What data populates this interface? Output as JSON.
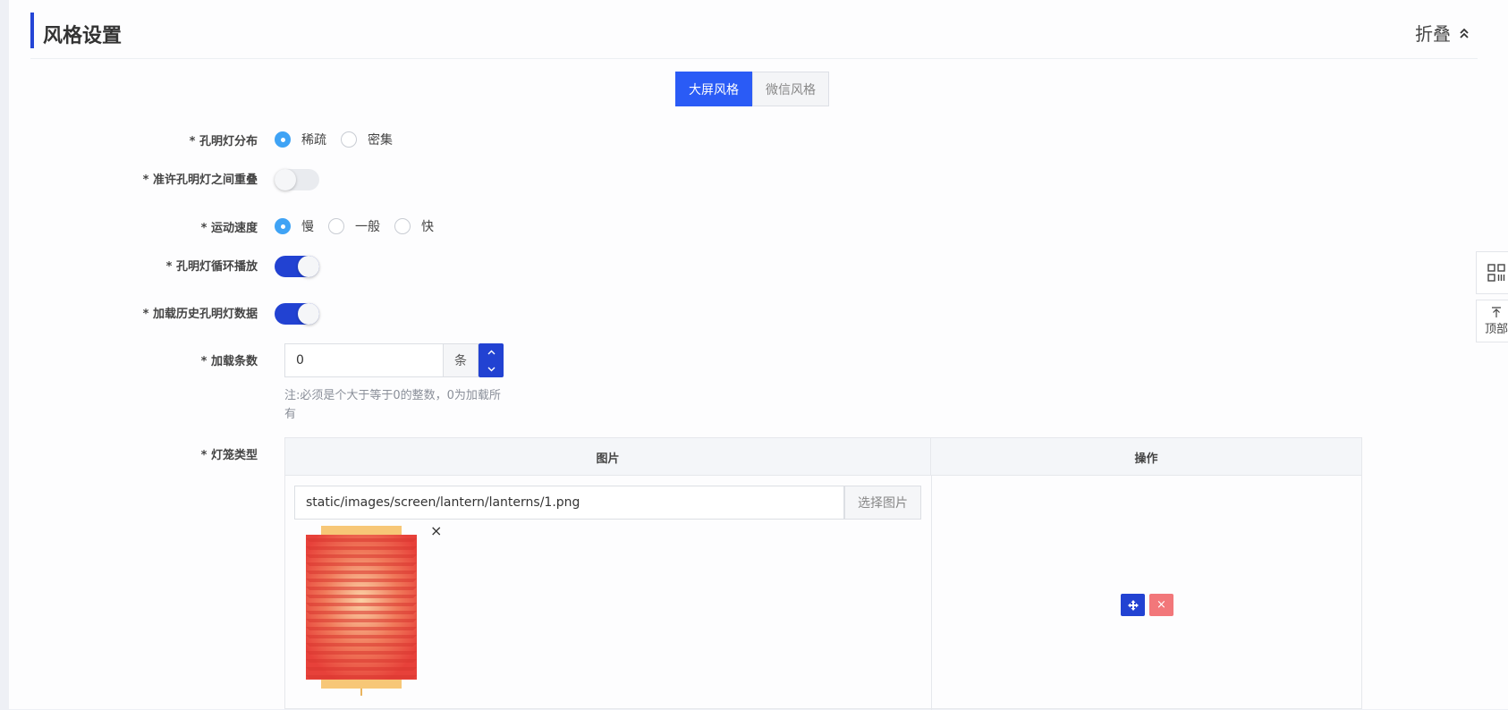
{
  "header": {
    "title": "风格设置",
    "collapse_label": "折叠",
    "accent": "#2445d6"
  },
  "tabs": [
    {
      "label": "大屏风格",
      "active": true
    },
    {
      "label": "微信风格",
      "active": false
    }
  ],
  "form": {
    "distribution": {
      "label": "* 孔明灯分布",
      "options": [
        "稀疏",
        "密集"
      ],
      "selected": "稀疏"
    },
    "overlap": {
      "label": "* 准许孔明灯之间重叠",
      "on": false
    },
    "speed": {
      "label": "* 运动速度",
      "options": [
        "慢",
        "一般",
        "快"
      ],
      "selected": "慢"
    },
    "loop": {
      "label": "* 孔明灯循环播放",
      "on": true
    },
    "history": {
      "label": "* 加载历史孔明灯数据",
      "on": true
    },
    "count": {
      "label": "* 加载条数",
      "value": "0",
      "unit": "条",
      "note": "注:必须是个大于等于0的整数，0为加载所有"
    },
    "lantern_type": {
      "label": "* 灯笼类型"
    }
  },
  "table": {
    "headers": [
      "图片",
      "操作"
    ],
    "rows": [
      {
        "path": "static/images/screen/lantern/lanterns/1.png",
        "choose_label": "选择图片",
        "remove_symbol": "×",
        "delete_symbol": "×"
      }
    ]
  },
  "side_tools": {
    "top_label": "顶部"
  },
  "colors": {
    "primary": "#2242d2",
    "tab_active": "#2a5bf6",
    "radio": "#3fa3f5",
    "danger": "#f2777a"
  }
}
